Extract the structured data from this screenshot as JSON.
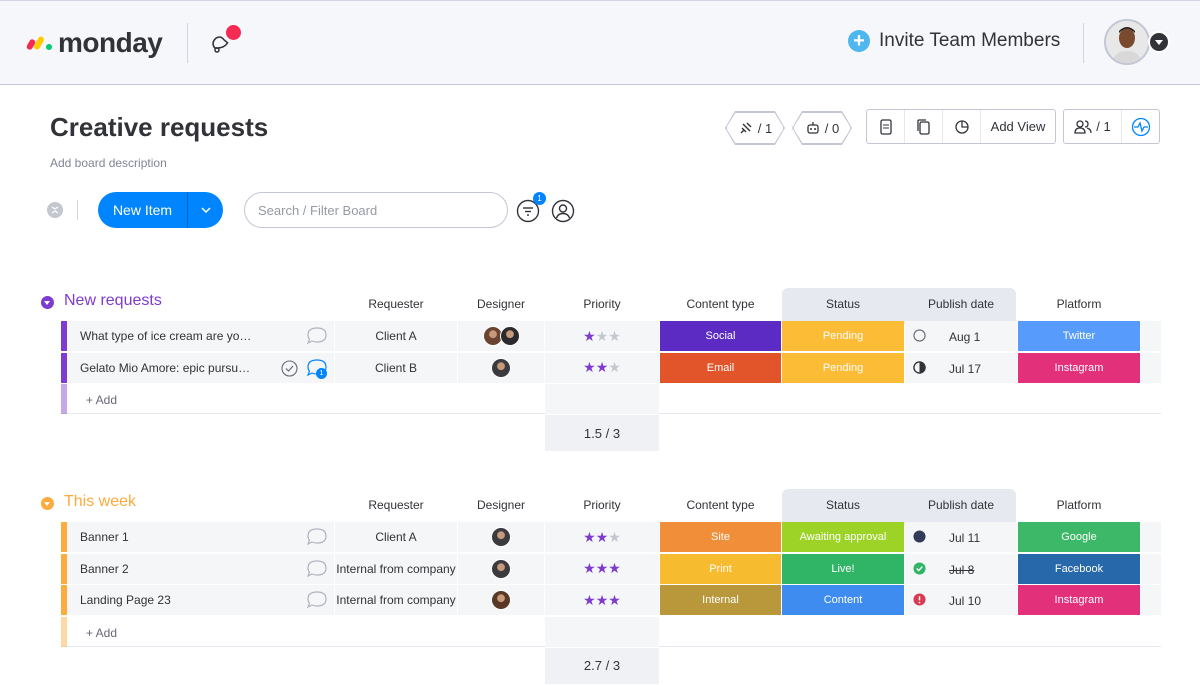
{
  "app": {
    "logo_text": "monday"
  },
  "topbar": {
    "invite_label": "Invite Team Members"
  },
  "board": {
    "title": "Creative requests",
    "description": "Add board description",
    "counters": [
      {
        "label": "/ 1"
      },
      {
        "label": "/ 0"
      }
    ],
    "add_view_label": "Add View",
    "members_label": "/ 1"
  },
  "toolbar": {
    "new_item_label": "New Item",
    "search_placeholder": "Search / Filter Board",
    "filter_badge": "1"
  },
  "columns": {
    "requester": "Requester",
    "designer": "Designer",
    "priority": "Priority",
    "content_type": "Content type",
    "status": "Status",
    "publish_date": "Publish date",
    "platform": "Platform"
  },
  "groups": [
    {
      "title": "New requests",
      "color": "#7e3bd0",
      "add_label": "+ Add",
      "priority_summary": "1.5 / 3",
      "rows": [
        {
          "name": "What type of ice cream are you?",
          "requester": "Client A",
          "priority": 1,
          "content_type": "Social",
          "content_color": "#5b2bc4",
          "status": "Pending",
          "status_color": "#fdbc35",
          "date_icon": "empty-circle-icon",
          "publish_date": "Aug 1",
          "platform": "Twitter",
          "platform_color": "#579bfc",
          "chat_badge": ""
        },
        {
          "name": "Gelato Mio Amore: epic pursuit ...",
          "requester": "Client B",
          "priority": 2,
          "content_type": "Email",
          "content_color": "#e2552a",
          "status": "Pending",
          "status_color": "#fdbc35",
          "date_icon": "half-circle-icon",
          "publish_date": "Jul 17",
          "platform": "Instagram",
          "platform_color": "#e2307a",
          "chat_badge": "1"
        }
      ]
    },
    {
      "title": "This week",
      "color": "#fdab3d",
      "add_label": "+ Add",
      "priority_summary": "2.7 / 3",
      "rows": [
        {
          "name": "Banner 1",
          "requester": "Client A",
          "priority": 2,
          "content_type": "Site",
          "content_color": "#f18e3a",
          "status": "Awaiting approval",
          "status_color": "#9cd326",
          "date_icon": "navy-dot-icon",
          "publish_date": "Jul 11",
          "platform": "Google",
          "platform_color": "#3cb868"
        },
        {
          "name": "Banner 2",
          "requester": "Internal from company",
          "priority": 3,
          "content_type": "Print",
          "content_color": "#f6bb2f",
          "status": "Live!",
          "status_color": "#2fb565",
          "date_icon": "green-check-icon",
          "publish_date": "Jul 8",
          "platform": "Facebook",
          "platform_color": "#2768ab"
        },
        {
          "name": "Landing Page 23",
          "requester": "Internal from company",
          "priority": 3,
          "content_type": "Internal",
          "content_color": "#b8983a",
          "status": "Content",
          "status_color": "#3f8cf0",
          "date_icon": "red-alert-icon",
          "publish_date": "Jul 10",
          "platform": "Instagram",
          "platform_color": "#e2307a"
        }
      ]
    }
  ]
}
